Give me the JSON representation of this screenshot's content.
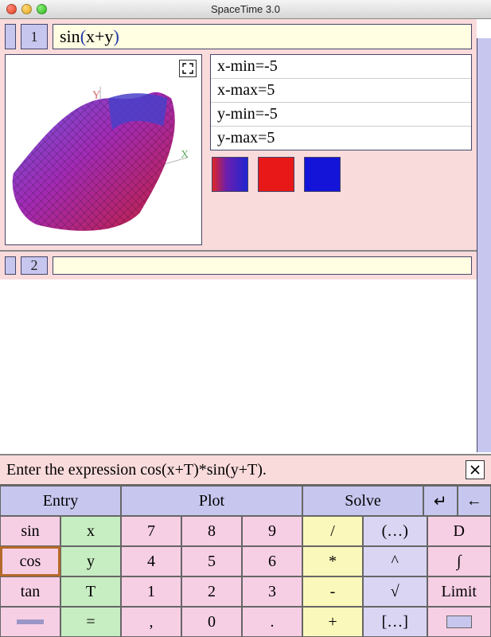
{
  "window": {
    "title": "SpaceTime 3.0"
  },
  "rows": [
    {
      "num": "1",
      "expr_plain": "sin",
      "expr_open": "(",
      "expr_body": "x+y",
      "expr_close": ")"
    },
    {
      "num": "2",
      "expr_plain": "",
      "expr_open": "",
      "expr_body": "",
      "expr_close": ""
    }
  ],
  "params": {
    "xmin": "x-min=-5",
    "xmax": "x-max=5",
    "ymin": "y-min=-5",
    "ymax": "y-max=5"
  },
  "hint": "Enter the expression cos(x+T)*sin(y+T).",
  "keypad": {
    "headers": {
      "entry": "Entry",
      "plot": "Plot",
      "solve": "Solve",
      "enter": "↵",
      "back": "←"
    },
    "r1": {
      "a": "sin",
      "b": "x",
      "c": "7",
      "d": "8",
      "e": "9",
      "f": "/",
      "g": "(…)",
      "h": "D"
    },
    "r2": {
      "a": "cos",
      "b": "y",
      "c": "4",
      "d": "5",
      "e": "6",
      "f": "*",
      "g": "^",
      "h": "∫"
    },
    "r3": {
      "a": "tan",
      "b": "T",
      "c": "1",
      "d": "2",
      "e": "3",
      "f": "-",
      "g": "√",
      "h": "Limit"
    },
    "r4": {
      "a": "",
      "b": "=",
      "c": ",",
      "d": "0",
      "e": ".",
      "f": "+",
      "g": "[…]",
      "h": ""
    }
  }
}
